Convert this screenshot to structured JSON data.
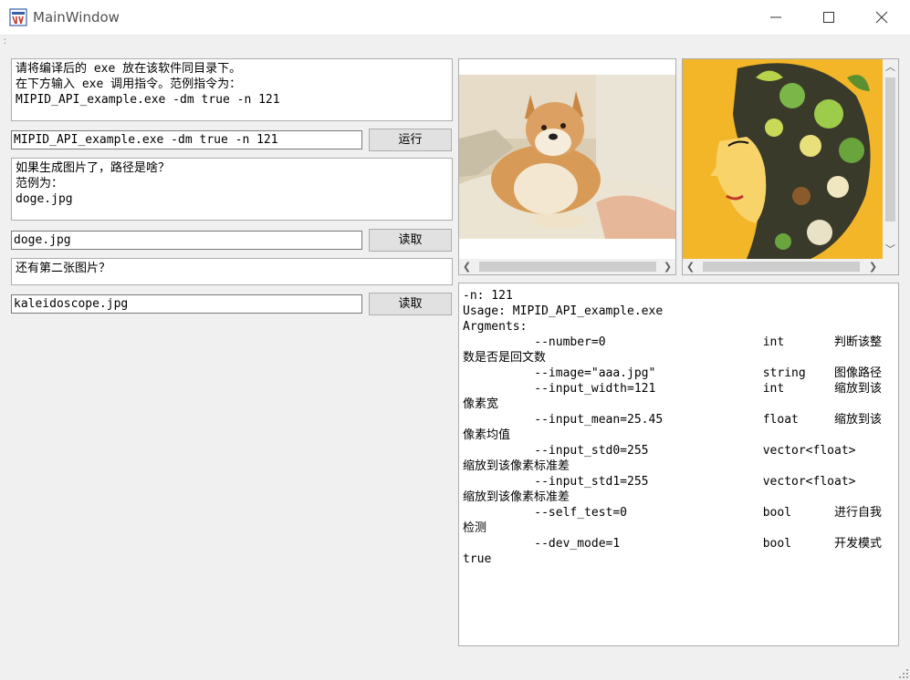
{
  "window": {
    "title": "MainWindow",
    "minimize_icon": "minimize-icon",
    "maximize_icon": "maximize-icon",
    "close_icon": "close-icon"
  },
  "left": {
    "instructions_text": "请将编译后的 exe 放在该软件同目录下。\n在下方输入 exe 调用指令。范例指令为：\nMIPID_API_example.exe -dm true -n 121",
    "command_input": "MIPID_API_example.exe -dm true -n 121",
    "run_button": "运行",
    "image_hint_text": "如果生成图片了，路径是啥？\n范例为：\ndoge.jpg",
    "image1_input": "doge.jpg",
    "read_button1": "读取",
    "second_image_hint": "还有第二张图片？",
    "image2_input": "kaleidoscope.jpg",
    "read_button2": "读取"
  },
  "images": {
    "left_image": "photo of a shiba inu dog lying on a sofa",
    "right_image": "colorful illustration of a woman's profile with leaves in her hair"
  },
  "console": {
    "lines": [
      "-n: 121",
      "Usage: MIPID_API_example.exe",
      "Argments:",
      "          --number=0                      int       判断该整",
      "数是否是回文数",
      "          --image=\"aaa.jpg\"               string    图像路径",
      "          --input_width=121               int       缩放到该",
      "像素宽",
      "          --input_mean=25.45              float     缩放到该",
      "像素均值",
      "          --input_std0=255                vector<float>",
      "缩放到该像素标准差",
      "          --input_std1=255                vector<float>",
      "缩放到该像素标准差",
      "          --self_test=0                   bool      进行自我",
      "检测",
      "          --dev_mode=1                    bool      开发模式",
      "true"
    ]
  },
  "colors": {
    "window_bg": "#f0f0f0",
    "field_border": "#7a7a7a",
    "button_bg": "#e1e1e1"
  }
}
